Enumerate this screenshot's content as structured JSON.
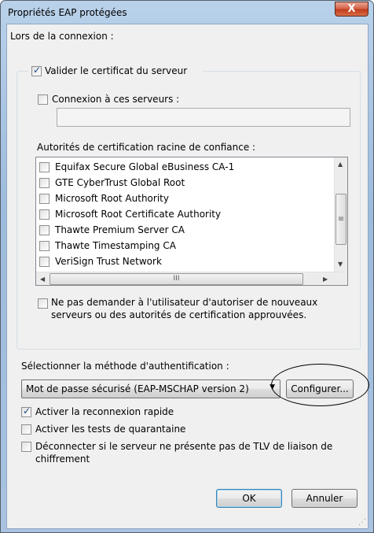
{
  "window": {
    "title": "Propriétés EAP protégées",
    "close_label": "X"
  },
  "connection": {
    "heading": "Lors de la connexion :",
    "validate_cert": {
      "label": "Valider le certificat du serveur",
      "checked": true
    },
    "connect_servers": {
      "label": "Connexion à ces serveurs :",
      "checked": false,
      "value": ""
    },
    "root_ca_label": "Autorités de certification racine de confiance :",
    "root_cas": [
      {
        "label": "Equifax Secure Global eBusiness CA-1",
        "checked": false
      },
      {
        "label": "GTE CyberTrust Global Root",
        "checked": false
      },
      {
        "label": "Microsoft Root Authority",
        "checked": false
      },
      {
        "label": "Microsoft Root Certificate Authority",
        "checked": false
      },
      {
        "label": "Thawte Premium Server CA",
        "checked": false
      },
      {
        "label": "Thawte Timestamping CA",
        "checked": false
      },
      {
        "label": "VeriSign Trust Network",
        "checked": false
      }
    ],
    "no_prompt": {
      "label_line1": "Ne pas demander à l'utilisateur d'autoriser de nouveaux",
      "label_line2": "serveurs ou des autorités de certification approuvées.",
      "checked": false
    }
  },
  "auth": {
    "heading": "Sélectionner la méthode d'authentification :",
    "method_value": "Mot de passe sécurisé (EAP-MSCHAP version 2)",
    "configure_label": "Configurer..."
  },
  "options": {
    "fast_reconnect": {
      "label": "Activer la reconnexion rapide",
      "checked": true
    },
    "quarantine": {
      "label": "Activer les tests de quarantaine",
      "checked": false
    },
    "disconnect_tlv": {
      "label_line1": "Déconnecter si le serveur ne présente pas de TLV de liaison de",
      "label_line2": "chiffrement",
      "checked": false
    }
  },
  "buttons": {
    "ok": "OK",
    "cancel": "Annuler"
  },
  "icons": {
    "check": "✓",
    "scroll_up": "▲",
    "scroll_down": "▼",
    "scroll_left": "◀",
    "scroll_right": "▶",
    "thumb_grip": "III",
    "vthumb_grip": "≡",
    "dropdown": "▼"
  }
}
